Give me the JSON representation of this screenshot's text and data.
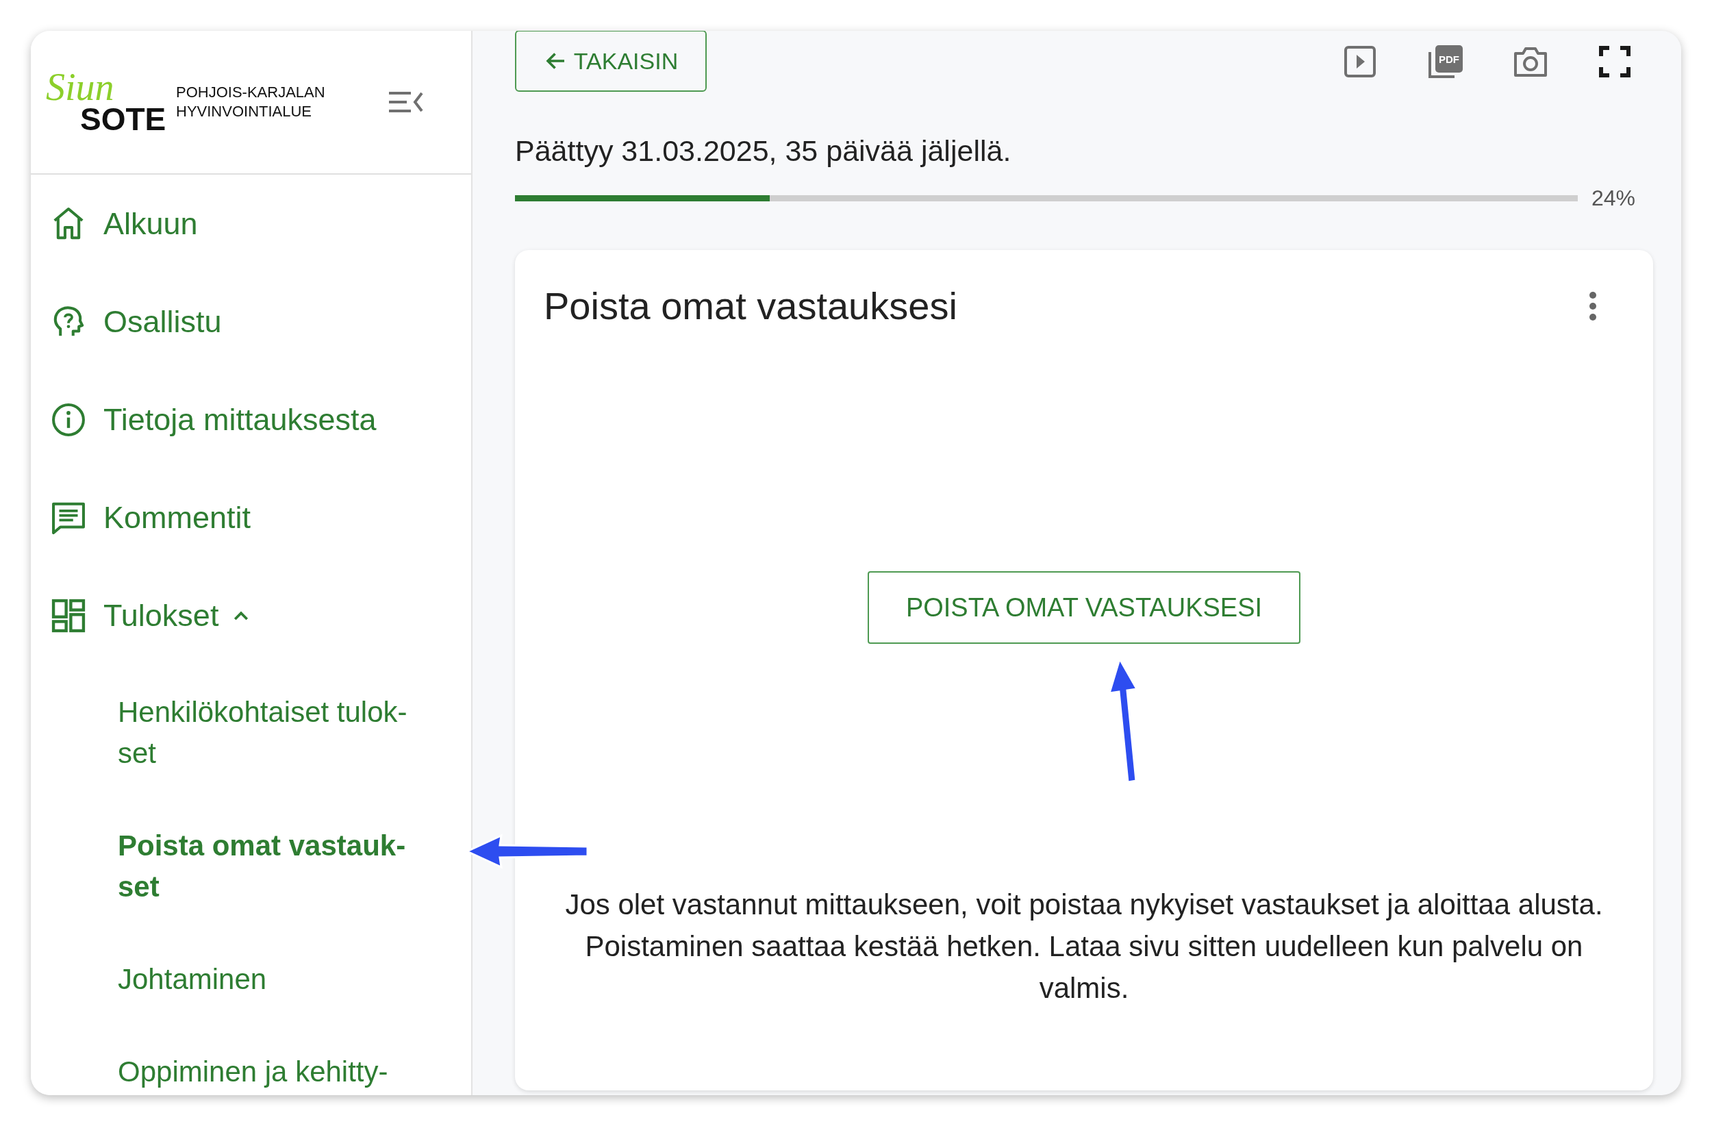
{
  "logo": {
    "script": "Siun",
    "wordmark": "SOTE",
    "line_1": "POHJOIS-KARJALAN",
    "line_2": "HYVINVOINTIALUE"
  },
  "sidebar": {
    "items": [
      {
        "label": "Alkuun"
      },
      {
        "label": "Osallistu"
      },
      {
        "label": "Tietoja mittauksesta"
      },
      {
        "label": "Kommentit"
      },
      {
        "label": "Tulokset",
        "expanded": true,
        "children": [
          {
            "label": "Henkilökohtaiset tulok-set",
            "selected": false
          },
          {
            "label": "Poista omat vastauk-set",
            "selected": true
          },
          {
            "label": "Johtaminen",
            "selected": false
          },
          {
            "label": "Oppiminen ja kehitty-",
            "selected": false
          }
        ]
      }
    ]
  },
  "toolbar": {
    "back_button": "TAKAISIN",
    "pdf_label": "PDF"
  },
  "deadline": "Päättyy 31.03.2025, 35 päivää jäljellä.",
  "progress": {
    "level": 0.24,
    "reading": "24%"
  },
  "card": {
    "title": "Poista omat vastauksesi",
    "button": "POISTA OMAT VASTAUKSESI",
    "text": "Jos olet vastannut mittaukseen, voit poistaa nykyiset vastaukset ja aloittaa alusta. Poistaminen saattaa kestää hetken. Lataa sivu sitten uudelleen kun palvelu on valmis."
  }
}
